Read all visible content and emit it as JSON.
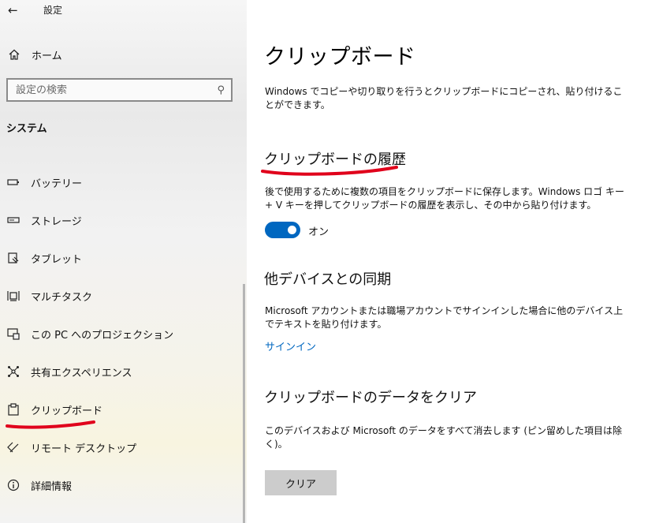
{
  "window": {
    "title": "設定"
  },
  "sidebar": {
    "home_label": "ホーム",
    "search_placeholder": "設定の検索",
    "section_label": "システム",
    "items": [
      {
        "label": "バッテリー",
        "icon": "battery-icon"
      },
      {
        "label": "ストレージ",
        "icon": "storage-icon"
      },
      {
        "label": "タブレット",
        "icon": "tablet-icon"
      },
      {
        "label": "マルチタスク",
        "icon": "multitask-icon"
      },
      {
        "label": "この PC へのプロジェクション",
        "icon": "projection-icon"
      },
      {
        "label": "共有エクスペリエンス",
        "icon": "shared-experience-icon"
      },
      {
        "label": "クリップボード",
        "icon": "clipboard-icon",
        "selected": true
      },
      {
        "label": "リモート デスクトップ",
        "icon": "remote-desktop-icon"
      },
      {
        "label": "詳細情報",
        "icon": "info-icon"
      }
    ]
  },
  "main": {
    "title": "クリップボード",
    "description": "Windows でコピーや切り取りを行うとクリップボードにコピーされ、貼り付けることができます。",
    "history": {
      "heading": "クリップボードの履歴",
      "description": "後で使用するために複数の項目をクリップボードに保存します。Windows ロゴ キー + V キーを押してクリップボードの履歴を表示し、その中から貼り付けます。",
      "toggle_state": "on",
      "toggle_label": "オン"
    },
    "sync": {
      "heading": "他デバイスとの同期",
      "description": "Microsoft アカウントまたは職場アカウントでサインインした場合に他のデバイス上でテキストを貼り付けます。",
      "link_label": "サインイン"
    },
    "clear": {
      "heading": "クリップボードのデータをクリア",
      "description": "このデバイスおよび Microsoft のデータをすべて消去します (ピン留めした項目は除く)。",
      "button_label": "クリア"
    }
  },
  "colors": {
    "accent": "#0067c0",
    "annotation": "#e0001b",
    "button_bg": "#cccccc"
  }
}
